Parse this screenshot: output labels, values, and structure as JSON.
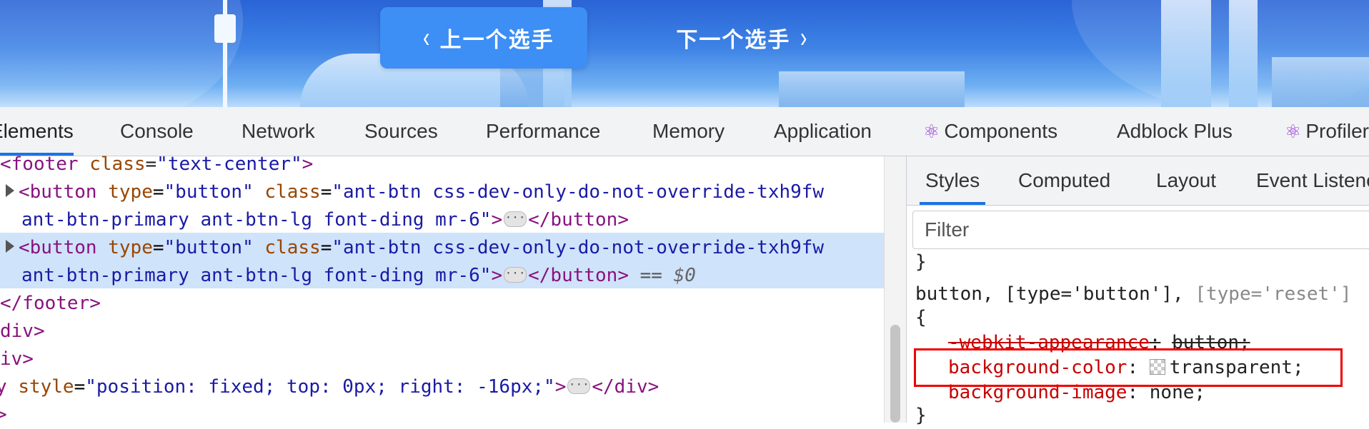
{
  "banner": {
    "prev_label": "上一个选手",
    "next_label": "下一个选手",
    "prev_chevron": "‹",
    "next_chevron": "›",
    "accent_color": "#3d8ef5"
  },
  "devtools": {
    "tabs": [
      "Elements",
      "Console",
      "Network",
      "Sources",
      "Performance",
      "Memory",
      "Application",
      "Components",
      "Adblock Plus",
      "Profiler"
    ],
    "active_tab": "Elements",
    "react_icon": "⚛"
  },
  "elements": {
    "l1": {
      "tag_open": "<footer",
      "attr": "class",
      "eq": "=",
      "val": "\"text-center\"",
      "close": ">"
    },
    "l2": {
      "tag_open": "<button",
      "a1": "type",
      "v1": "\"button\"",
      "a2": "class",
      "v2": "\"ant-btn css-dev-only-do-not-override-txh9fw"
    },
    "l3": {
      "v_cont": "ant-btn-primary ant-btn-lg font-ding mr-6\"",
      "gt": ">",
      "ell": "···",
      "close_tag": "</button>"
    },
    "l4": {
      "tag_open": "<button",
      "a1": "type",
      "v1": "\"button\"",
      "a2": "class",
      "v2": "\"ant-btn css-dev-only-do-not-override-txh9fw"
    },
    "l5": {
      "v_cont": "ant-btn-primary ant-btn-lg font-ding mr-6\"",
      "gt": ">",
      "ell": "···",
      "close_tag": "</button>",
      "marker": "==",
      "dollar": "$0"
    },
    "l6": "</footer>",
    "l7": "div>",
    "l8": "iv>",
    "l9": {
      "prefix": "y",
      "attr": "style",
      "val": "\"position: fixed; top: 0px; right: -16px;\"",
      "gt": ">",
      "ell": "···",
      "close_tag": "</div>"
    },
    "l10": ">"
  },
  "styles": {
    "subtabs": [
      "Styles",
      "Computed",
      "Layout",
      "Event Listeners"
    ],
    "active_subtab": "Styles",
    "filter_placeholder": "Filter",
    "brace_prev_close": "}",
    "selector_main": "button, [type='button'],",
    "selector_dim": "[type='reset']",
    "brace_open": "{",
    "decl1": {
      "prop": "-webkit-appearance",
      "value": "button;"
    },
    "decl2": {
      "prop": "background-color",
      "value": "transparent;"
    },
    "decl3": {
      "prop": "background-image",
      "value": "none;"
    },
    "brace_close": "}",
    "colon": ":"
  }
}
